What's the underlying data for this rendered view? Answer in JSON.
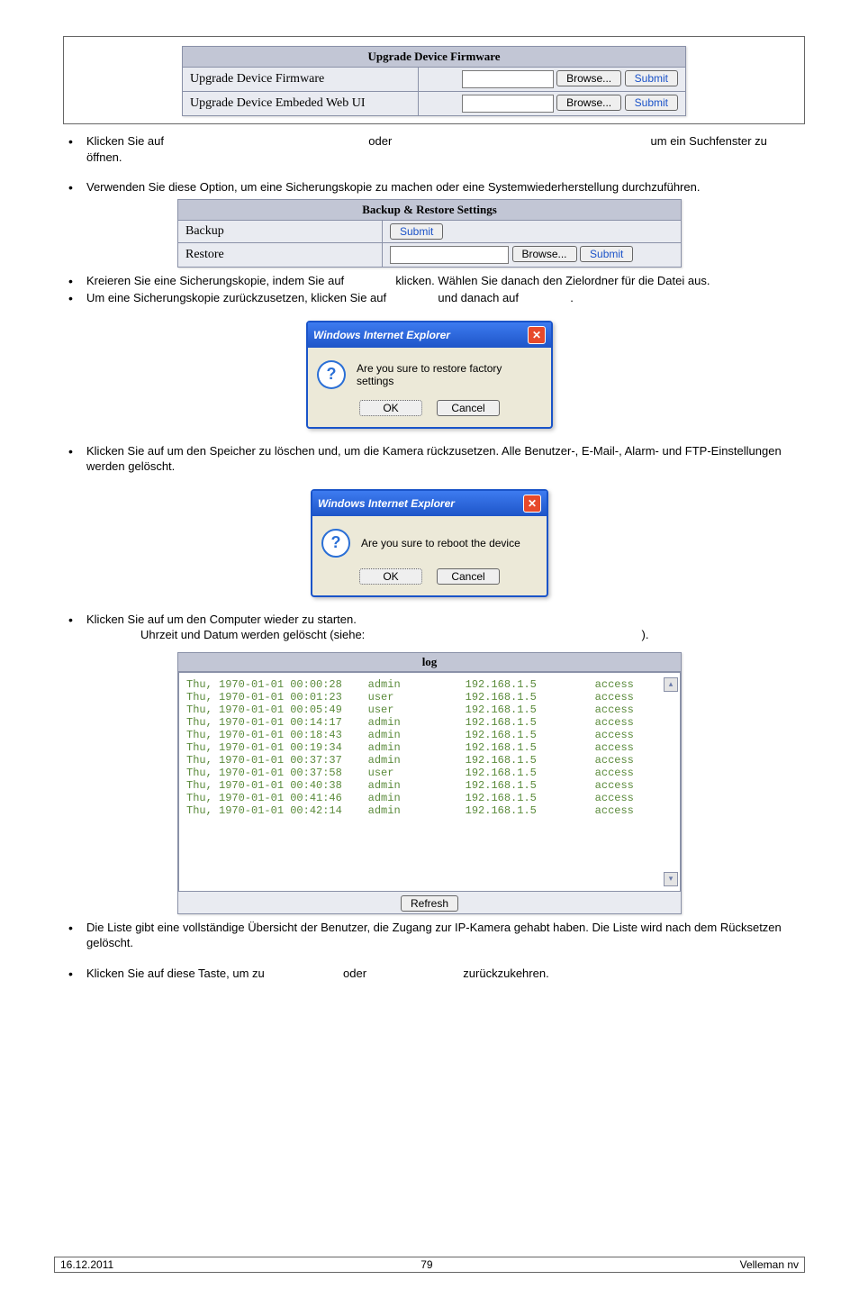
{
  "upgrade": {
    "header": "Upgrade Device Firmware",
    "row1_label": "Upgrade Device Firmware",
    "row2_label": "Upgrade Device Embeded Web UI",
    "browse": "Browse...",
    "submit": "Submit"
  },
  "bullets": {
    "b1a": "Klicken Sie auf",
    "b1b": "oder",
    "b1c": "um ein Suchfenster zu öffnen.",
    "b2": "Verwenden Sie diese Option, um eine Sicherungskopie zu machen oder eine Systemwiederherstellung durchzuführen.",
    "b3a": "Kreieren Sie eine Sicherungskopie, indem Sie auf",
    "b3b": "klicken. Wählen Sie danach den Zielordner für die Datei aus.",
    "b4a": "Um eine Sicherungskopie zurückzusetzen, klicken Sie auf",
    "b4b": "und danach auf",
    "b4c": ".",
    "b5": "Klicken Sie auf        um den Speicher zu löschen und, um die Kamera rückzusetzen. Alle Benutzer-, E-Mail-, Alarm- und FTP-Einstellungen werden gelöscht.",
    "b6a": "Klicken Sie auf        um den Computer wieder zu starten.",
    "b6b": "Uhrzeit und Datum werden gelöscht (siehe:",
    "b6c": ").",
    "b7": "Die Liste gibt eine vollständige Übersicht der Benutzer, die Zugang zur IP-Kamera gehabt haben. Die Liste wird nach dem Rücksetzen gelöscht.",
    "b8a": "Klicken Sie auf diese Taste, um zu",
    "b8b": "oder",
    "b8c": "zurückzukehren."
  },
  "backup": {
    "header": "Backup & Restore Settings",
    "row1_label": "Backup",
    "row2_label": "Restore",
    "submit": "Submit",
    "browse": "Browse..."
  },
  "dialog1": {
    "title": "Windows Internet Explorer",
    "msg": "Are you sure to restore factory settings",
    "ok": "OK",
    "cancel": "Cancel"
  },
  "dialog2": {
    "title": "Windows Internet Explorer",
    "msg": "Are you sure to reboot the device",
    "ok": "OK",
    "cancel": "Cancel"
  },
  "log": {
    "header": "log",
    "refresh": "Refresh",
    "rows": [
      "Thu, 1970-01-01 00:00:28    admin          192.168.1.5         access",
      "Thu, 1970-01-01 00:01:23    user           192.168.1.5         access",
      "Thu, 1970-01-01 00:05:49    user           192.168.1.5         access",
      "Thu, 1970-01-01 00:14:17    admin          192.168.1.5         access",
      "Thu, 1970-01-01 00:18:43    admin          192.168.1.5         access",
      "Thu, 1970-01-01 00:19:34    admin          192.168.1.5         access",
      "Thu, 1970-01-01 00:37:37    admin          192.168.1.5         access",
      "Thu, 1970-01-01 00:37:58    user           192.168.1.5         access",
      "Thu, 1970-01-01 00:40:38    admin          192.168.1.5         access",
      "Thu, 1970-01-01 00:41:46    admin          192.168.1.5         access",
      "Thu, 1970-01-01 00:42:14    admin          192.168.1.5         access"
    ]
  },
  "footer": {
    "date": "16.12.2011",
    "page": "79",
    "company": "Velleman nv"
  }
}
